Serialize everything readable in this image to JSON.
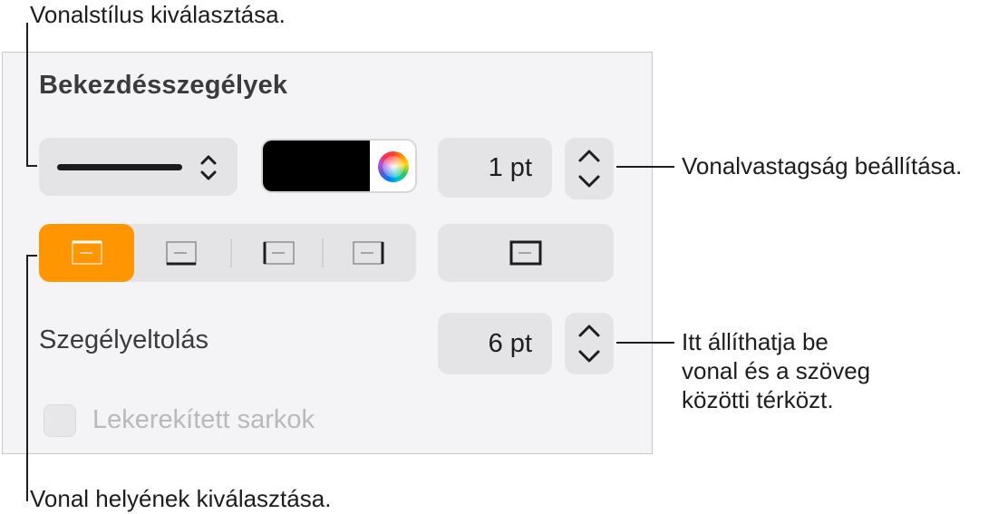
{
  "callouts": {
    "line_style": "Vonalstílus kiválasztása.",
    "line_thickness": "Vonalvastagság beállítása.",
    "spacing_lines": [
      "Itt állíthatja be",
      "vonal és a szöveg",
      "közötti térközt."
    ],
    "line_position": "Vonal helyének kiválasztása."
  },
  "panel": {
    "title": "Bekezdésszegélyek",
    "line_style": {
      "value": "solid"
    },
    "color": {
      "value": "#000000"
    },
    "thickness": {
      "value": "1 pt"
    },
    "position_buttons": [
      {
        "name": "top",
        "selected": true
      },
      {
        "name": "bottom",
        "selected": false
      },
      {
        "name": "left",
        "selected": false
      },
      {
        "name": "right",
        "selected": false
      }
    ],
    "all_borders": {
      "selected": false
    },
    "offset": {
      "label": "Szegélyeltolás",
      "value": "6 pt"
    },
    "rounded_corners": {
      "label": "Lekerekített sarkok",
      "checked": false,
      "enabled": false
    }
  },
  "colors": {
    "accent": "#ff9500",
    "panel_bg": "#f4f4f6",
    "control_bg": "#e4e4e6"
  }
}
